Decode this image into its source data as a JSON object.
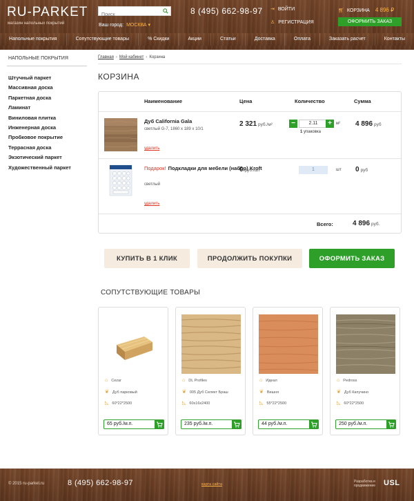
{
  "header": {
    "logo": "RU-PARKET",
    "tagline": "магазин напольных покрытий",
    "search_placeholder": "Поиск",
    "city_label": "Ваш город:",
    "city_value": "МОСКВА ▾",
    "phone": "8 (495) 662-98-97",
    "login": "ВОЙТИ",
    "register": "РЕГИСТРАЦИЯ",
    "cart_label": "КОРЗИНА",
    "cart_total": "4 896 ₽",
    "order_button": "ОФОРМИТЬ ЗАКАЗ",
    "accent_color": "#ffb347",
    "button_color": "#2ea02a"
  },
  "nav": [
    "Напольные покрытия",
    "Сопутствующие товары",
    "% Скидки",
    "Акции",
    "Статьи",
    "Доставка",
    "Оплата",
    "Заказать расчет",
    "Контакты"
  ],
  "sidebar": {
    "title": "НАПОЛЬНЫЕ ПОКРЫТИЯ",
    "items": [
      "Штучный паркет",
      "Массивная доска",
      "Паркетная доска",
      "Ламинат",
      "Виниловая плитка",
      "Инженерная доска",
      "Пробковое покрытие",
      "Террасная доска",
      "Экзотический паркет",
      "Художественный паркет"
    ]
  },
  "breadcrumbs": [
    "Главная",
    "Мой кабинет",
    "Корзина"
  ],
  "page_title": "КОРЗИНА",
  "cart": {
    "headers": {
      "name": "Наименование",
      "price": "Цена",
      "qty": "Количество",
      "sum": "Сумма"
    },
    "items": [
      {
        "promo": "",
        "name": "Дуб California Gala",
        "sub": "светлый G-7, 1860 х 189 х 10/1",
        "delete": "удалить",
        "price": "2 321",
        "price_unit": "руб./м²",
        "qty": "2.11",
        "qty_unit": "м²",
        "pack_count": "1",
        "pack_label": "упаковка",
        "sum": "4 896",
        "sum_unit": "руб"
      },
      {
        "promo": "Подарок!",
        "name": "Подкладки для мебели (набор) Kroft",
        "sub": "светлый",
        "delete": "удалить",
        "price": "0",
        "price_unit": "руб./шт",
        "qty": "1",
        "qty_unit": "шт",
        "sum": "0",
        "sum_unit": "руб"
      }
    ],
    "total_label": "Всего:",
    "total_value": "4 896",
    "total_unit": "руб."
  },
  "actions": {
    "one_click": "КУПИТЬ В 1 КЛИК",
    "continue": "ПРОДОЛЖИТЬ ПОКУПКИ",
    "checkout": "ОФОРМИТЬ ЗАКАЗ"
  },
  "related": {
    "title": "СОПУТСТВУЮЩИЕ ТОВАРЫ",
    "items": [
      {
        "brand": "Cezar",
        "name": "Дуб парковый",
        "size": "60*22*2500",
        "price": "65 руб./м.п."
      },
      {
        "brand": "DL Profiles",
        "name": "005 Дуб Селект Браш",
        "size": "60х16х2400",
        "price": "235 руб./м.п."
      },
      {
        "brand": "Идеал",
        "name": "Вишня",
        "size": "55*22*2500",
        "price": "44 руб./м.п."
      },
      {
        "brand": "Pedross",
        "name": "Дуб Капучино",
        "size": "60*22*2500",
        "price": "250 руб./м.п."
      }
    ]
  },
  "footer": {
    "copyright": "© 2015 ru-parket.ru",
    "phone": "8 (495) 662-98-97",
    "site_map": "карта сайта",
    "dev_line1": "Разработка и",
    "dev_line2": "продвижение",
    "dev_logo": "USL"
  }
}
